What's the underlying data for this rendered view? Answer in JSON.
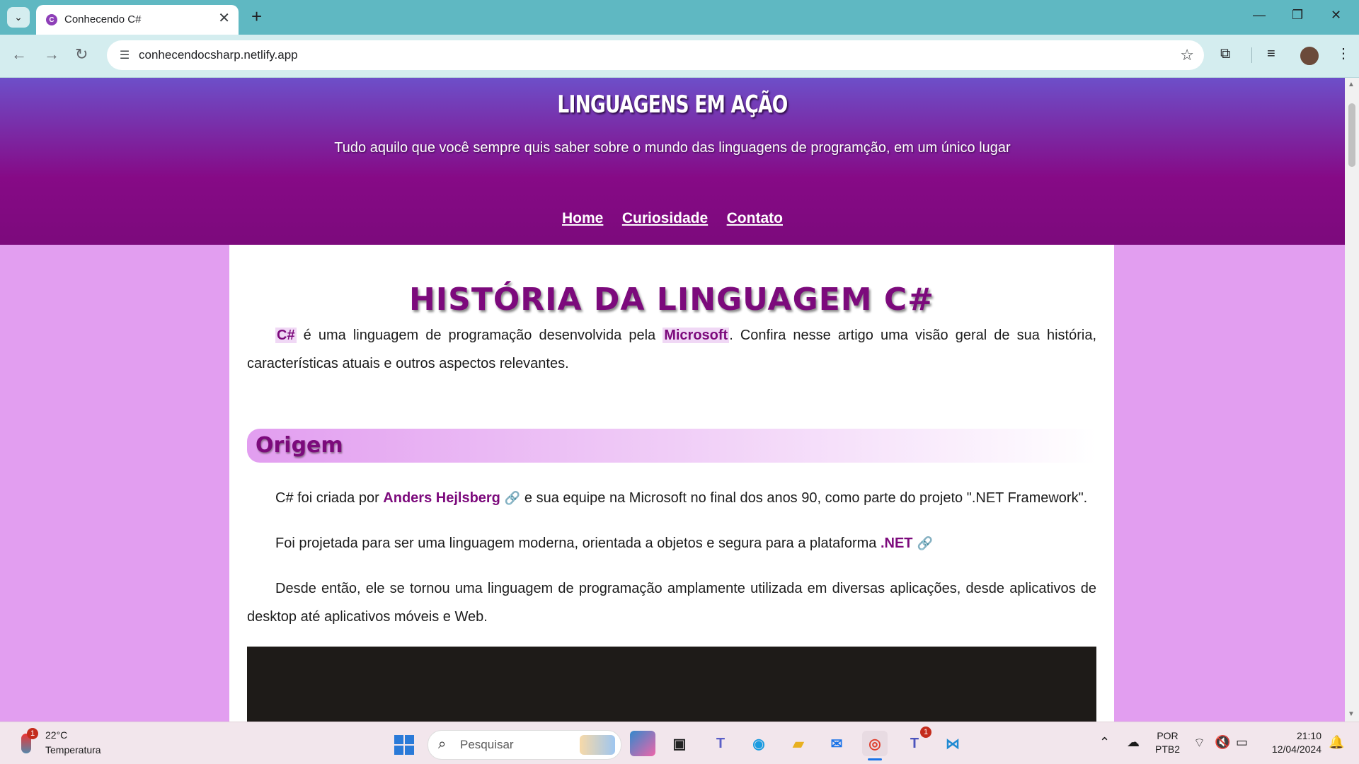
{
  "browser": {
    "tab_title": "Conhecendo C#",
    "url": "conhecendocsharp.netlify.app"
  },
  "site": {
    "title": "LINGUAGENS EM AÇÃO",
    "subtitle": "Tudo aquilo que você sempre quis saber sobre o mundo das linguagens de programção, em um único lugar",
    "nav": [
      "Home",
      "Curiosidade",
      "Contato"
    ]
  },
  "article": {
    "heading": "HISTÓRIA DA LINGUAGEM C#",
    "intro": {
      "kw1": "C#",
      "text1": " é uma linguagem de programação desenvolvida pela ",
      "kw2": "Microsoft",
      "text2": ". Confira nesse artigo uma visão geral de sua história, características atuais e outros aspectos relevantes."
    },
    "section_title": "Origem",
    "p1": {
      "text1": "C# foi criada por ",
      "link": "Anders Hejlsberg",
      "text2": " e sua equipe na Microsoft no final dos anos 90, como parte do projeto \".NET Framework\"."
    },
    "p2": {
      "text1": "Foi projetada para ser uma linguagem moderna, orientada a objetos e segura para a plataforma ",
      "link": ".NET"
    },
    "p3": "Desde então, ele se tornou uma linguagem de programação amplamente utilizada em diversas aplicações, desde aplicativos de desktop até aplicativos móveis e Web."
  },
  "taskbar": {
    "weather_temp": "22°C",
    "weather_label": "Temperatura",
    "weather_badge": "1",
    "search_placeholder": "Pesquisar",
    "teams_badge": "1",
    "lang_line1": "POR",
    "lang_line2": "PTB2",
    "time": "21:10",
    "date": "12/04/2024"
  },
  "colors": {
    "brand_purple": "#7c0a7c",
    "page_bg": "#e29ef0",
    "header_top": "#6d4fc9"
  }
}
